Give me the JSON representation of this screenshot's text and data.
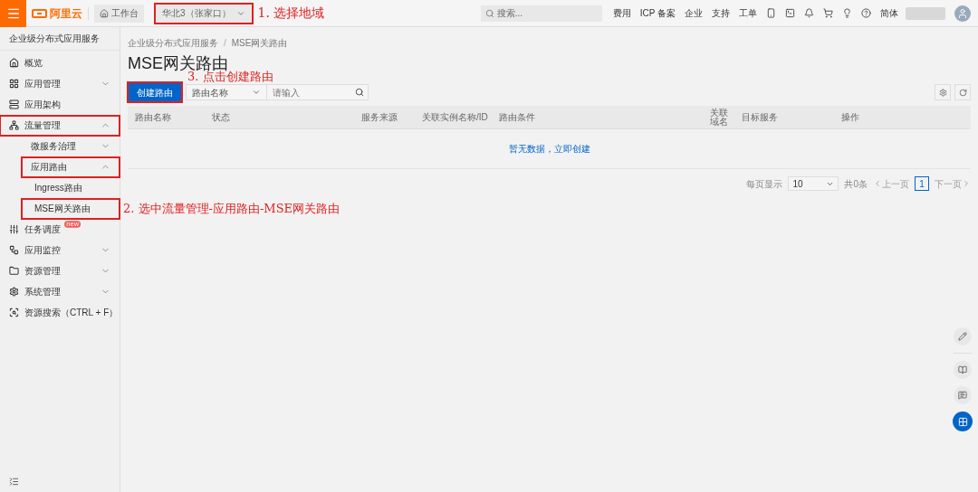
{
  "topbar": {
    "logo_text": "阿里云",
    "workbench": "工作台",
    "region": {
      "value": "华北3（张家口）",
      "annotated": true
    },
    "region_note": "1. 选择地域",
    "search_placeholder": "搜索...",
    "links": [
      "费用",
      "ICP 备案",
      "企业",
      "支持",
      "工单"
    ],
    "language": "简体"
  },
  "sidebar": {
    "title": "企业级分布式应用服务",
    "items": [
      {
        "label": "概览",
        "annotated": false
      },
      {
        "label": "应用管理",
        "annotated": false,
        "expanded": false
      },
      {
        "label": "应用架构",
        "annotated": false
      },
      {
        "label": "流量管理",
        "annotated": true,
        "expanded": true,
        "children": [
          {
            "label": "微服务治理",
            "annotated": false,
            "expanded": false
          },
          {
            "label": "应用路由",
            "annotated": true,
            "expanded": true,
            "children": [
              {
                "label": "Ingress路由",
                "annotated": false
              },
              {
                "label": "MSE网关路由",
                "annotated": true,
                "note": "2. 选中流量管理-应用路由-MSE网关路由"
              }
            ]
          }
        ]
      },
      {
        "label": "任务调度",
        "annotated": false,
        "badge": "new"
      },
      {
        "label": "应用监控",
        "annotated": false,
        "expanded": false
      },
      {
        "label": "资源管理",
        "annotated": false,
        "expanded": false
      },
      {
        "label": "系统管理",
        "annotated": false,
        "expanded": false
      },
      {
        "label": "资源搜索（CTRL + F）",
        "annotated": false
      }
    ]
  },
  "content": {
    "breadcrumb": [
      "企业级分布式应用服务",
      "MSE网关路由"
    ],
    "breadcrumb_separator": "/",
    "title": "MSE网关路由",
    "create_button": {
      "label": "创建路由",
      "annotated": true
    },
    "create_note": "3. 点击创建路由",
    "filter_select": "路由名称",
    "search_placeholder": "请输入",
    "columns": [
      "路由名称",
      "状态",
      "服务来源",
      "关联实例名称/ID",
      "路由条件",
      "关联域名",
      "目标服务",
      "操作"
    ],
    "empty_text": "暂无数据，立即创建",
    "pagination": {
      "per_page_label": "每页显示",
      "page_size": "10",
      "total": "共0条",
      "prev": "上一页",
      "pages": [
        {
          "label": "1",
          "selected": true
        }
      ],
      "next": "下一页"
    }
  }
}
